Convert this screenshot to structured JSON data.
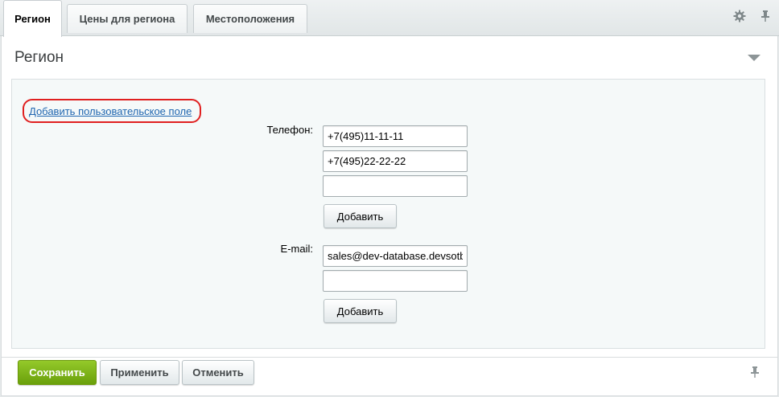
{
  "tabs": [
    {
      "label": "Регион",
      "active": true
    },
    {
      "label": "Цены для региона",
      "active": false
    },
    {
      "label": "Местоположения",
      "active": false
    }
  ],
  "toolbar": {
    "settings_icon": "gear-icon",
    "pin_icon": "pin-icon"
  },
  "section": {
    "title": "Регион",
    "collapse_icon": "triangle-down-icon"
  },
  "add_field_link": "Добавить пользовательское поле",
  "phone": {
    "label": "Телефон:",
    "values": [
      "+7(495)11-11-11",
      "+7(495)22-22-22",
      ""
    ],
    "add_button": "Добавить"
  },
  "email": {
    "label": "E-mail:",
    "values": [
      "sales@dev-database.devsotb",
      ""
    ],
    "add_button": "Добавить"
  },
  "footer": {
    "save": "Сохранить",
    "apply": "Применить",
    "cancel": "Отменить",
    "pin_icon": "pin-icon"
  },
  "colors": {
    "save_green": "#7fb51a",
    "link_blue": "#2066b0",
    "highlight_red": "#e02020"
  }
}
